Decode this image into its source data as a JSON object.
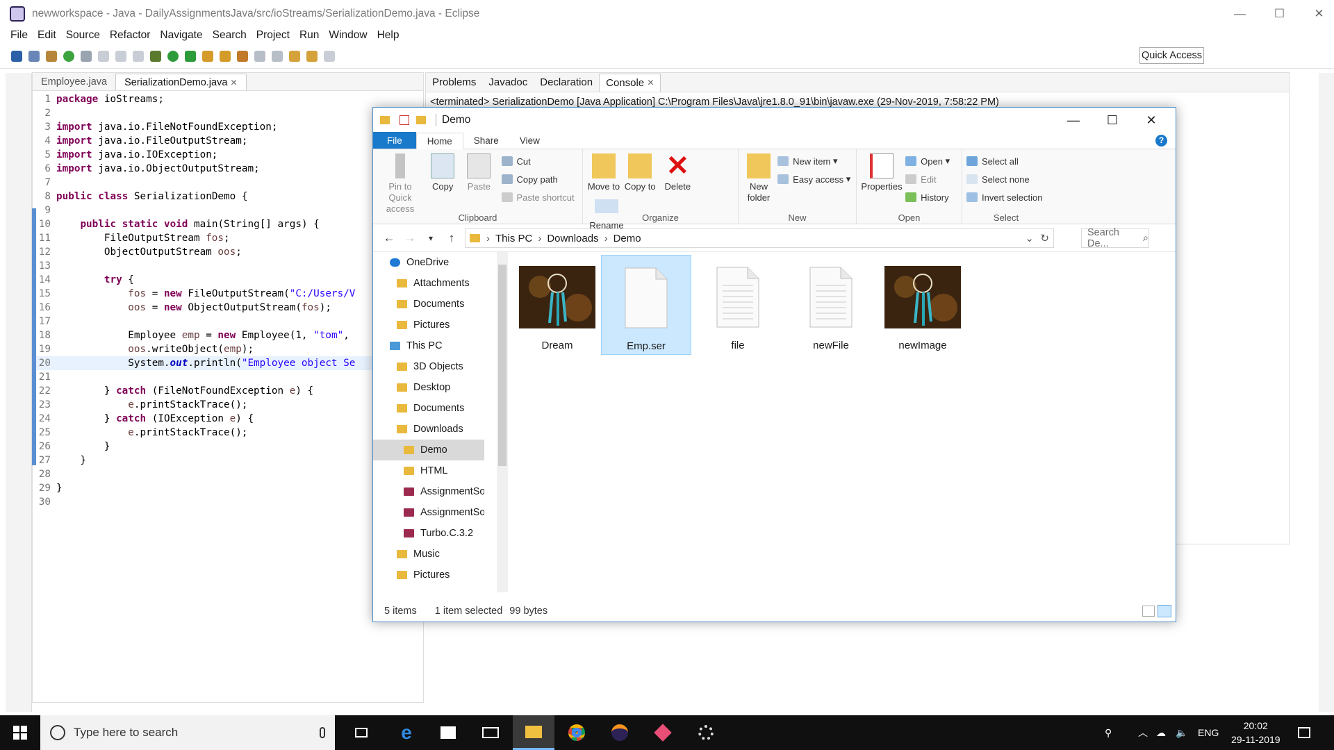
{
  "window": {
    "title": "newworkspace - Java - DailyAssignmentsJava/src/ioStreams/SerializationDemo.java - Eclipse",
    "minimize": "—",
    "maximize": "☐",
    "close": "✕"
  },
  "menu": [
    "File",
    "Edit",
    "Source",
    "Refactor",
    "Navigate",
    "Search",
    "Project",
    "Run",
    "Window",
    "Help"
  ],
  "quick_access": "Quick Access",
  "editor": {
    "tabs": [
      "Employee.java",
      "SerializationDemo.java"
    ],
    "close_glyph": "✕"
  },
  "code": {
    "lines": [
      {
        "n": "1",
        "t": "package ioStreams;"
      },
      {
        "n": "2",
        "t": ""
      },
      {
        "n": "3",
        "t": "import java.io.FileNotFoundException;"
      },
      {
        "n": "4",
        "t": "import java.io.FileOutputStream;"
      },
      {
        "n": "5",
        "t": "import java.io.IOException;"
      },
      {
        "n": "6",
        "t": "import java.io.ObjectOutputStream;"
      },
      {
        "n": "7",
        "t": ""
      },
      {
        "n": "8",
        "t": "public class SerializationDemo {"
      },
      {
        "n": "9",
        "t": ""
      },
      {
        "n": "10",
        "t": "    public static void main(String[] args) {"
      },
      {
        "n": "11",
        "t": "        FileOutputStream fos;"
      },
      {
        "n": "12",
        "t": "        ObjectOutputStream oos;"
      },
      {
        "n": "13",
        "t": ""
      },
      {
        "n": "14",
        "t": "        try {"
      },
      {
        "n": "15",
        "t": "            fos = new FileOutputStream(\"C:/Users/V"
      },
      {
        "n": "16",
        "t": "            oos = new ObjectOutputStream(fos);"
      },
      {
        "n": "17",
        "t": ""
      },
      {
        "n": "18",
        "t": "            Employee emp = new Employee(1, \"tom\","
      },
      {
        "n": "19",
        "t": "            oos.writeObject(emp);"
      },
      {
        "n": "20",
        "t": "            System.out.println(\"Employee object Se"
      },
      {
        "n": "21",
        "t": ""
      },
      {
        "n": "22",
        "t": "        } catch (FileNotFoundException e) {"
      },
      {
        "n": "23",
        "t": "            e.printStackTrace();"
      },
      {
        "n": "24",
        "t": "        } catch (IOException e) {"
      },
      {
        "n": "25",
        "t": "            e.printStackTrace();"
      },
      {
        "n": "26",
        "t": "        }"
      },
      {
        "n": "27",
        "t": "    }"
      },
      {
        "n": "28",
        "t": ""
      },
      {
        "n": "29",
        "t": "}"
      },
      {
        "n": "30",
        "t": ""
      }
    ]
  },
  "console": {
    "tabs": [
      "Problems",
      "Javadoc",
      "Declaration",
      "Console"
    ],
    "terminated": "<terminated> SerializationDemo [Java Application] C:\\Program Files\\Java\\jre1.8.0_91\\bin\\javaw.exe (29-Nov-2019, 7:58:22 PM)"
  },
  "explorer": {
    "title": "Demo",
    "controls": {
      "minimize": "—",
      "maximize": "☐",
      "close": "✕"
    },
    "ribbon_tabs": [
      "File",
      "Home",
      "Share",
      "View"
    ],
    "clipboard": {
      "pin": "Pin to Quick access",
      "copy": "Copy",
      "paste": "Paste",
      "cut": "Cut",
      "copy_path": "Copy path",
      "paste_shortcut": "Paste shortcut",
      "label": "Clipboard"
    },
    "organize": {
      "move_to": "Move to",
      "copy_to": "Copy to",
      "delete": "Delete",
      "rename": "Rename",
      "label": "Organize"
    },
    "new": {
      "new_folder": "New folder",
      "new_item": "New item",
      "easy_access": "Easy access",
      "label": "New"
    },
    "open": {
      "properties": "Properties",
      "open": "Open",
      "edit": "Edit",
      "history": "History",
      "label": "Open"
    },
    "select": {
      "select_all": "Select all",
      "select_none": "Select none",
      "invert": "Invert selection",
      "label": "Select"
    },
    "address": {
      "crumbs": [
        "This PC",
        "Downloads",
        "Demo"
      ],
      "search_placeholder": "Search De..."
    },
    "nav": [
      {
        "label": "OneDrive",
        "indent": 0,
        "type": "cloud"
      },
      {
        "label": "Attachments",
        "indent": 1,
        "type": "folder"
      },
      {
        "label": "Documents",
        "indent": 1,
        "type": "folder"
      },
      {
        "label": "Pictures",
        "indent": 1,
        "type": "folder"
      },
      {
        "label": "This PC",
        "indent": 0,
        "type": "pc"
      },
      {
        "label": "3D Objects",
        "indent": 1,
        "type": "folder"
      },
      {
        "label": "Desktop",
        "indent": 1,
        "type": "folder"
      },
      {
        "label": "Documents",
        "indent": 1,
        "type": "folder"
      },
      {
        "label": "Downloads",
        "indent": 1,
        "type": "folder"
      },
      {
        "label": "Demo",
        "indent": 2,
        "type": "folder"
      },
      {
        "label": "HTML",
        "indent": 2,
        "type": "folder"
      },
      {
        "label": "AssignmentSol",
        "indent": 2,
        "type": "archive"
      },
      {
        "label": "AssignmentSol",
        "indent": 2,
        "type": "archive"
      },
      {
        "label": "Turbo.C.3.2",
        "indent": 2,
        "type": "archive"
      },
      {
        "label": "Music",
        "indent": 1,
        "type": "folder"
      },
      {
        "label": "Pictures",
        "indent": 1,
        "type": "folder"
      }
    ],
    "selected_nav": "Demo",
    "files": [
      {
        "name": "Dream",
        "kind": "image"
      },
      {
        "name": "Emp.ser",
        "kind": "blank"
      },
      {
        "name": "file",
        "kind": "text"
      },
      {
        "name": "newFile",
        "kind": "text"
      },
      {
        "name": "newImage",
        "kind": "image"
      }
    ],
    "status": {
      "count": "5 items",
      "selected": "1 item selected",
      "size": "99 bytes"
    }
  },
  "taskbar": {
    "search_placeholder": "Type here to search",
    "lang": "ENG",
    "time": "20:02",
    "date": "29-11-2019"
  },
  "colors": {
    "accent": "#1979ca",
    "selection": "#cce8ff",
    "folder": "#e8b93c",
    "keyword": "#7f0055",
    "string": "#2a00ff"
  }
}
